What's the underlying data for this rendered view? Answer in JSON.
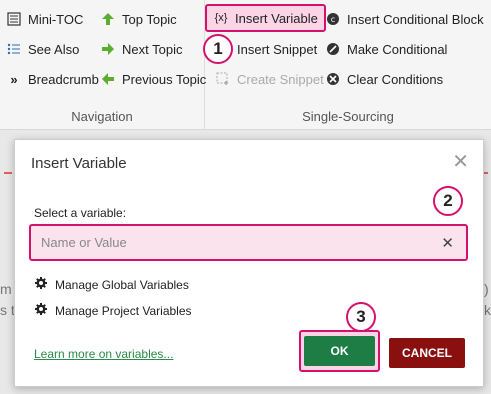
{
  "ribbon": {
    "navigation": {
      "label": "Navigation",
      "items": [
        {
          "label": "Mini-TOC",
          "icon": "mini-toc-icon"
        },
        {
          "label": "See Also",
          "icon": "list-icon"
        },
        {
          "label": "Breadcrumb",
          "icon": "double-chevron-icon"
        },
        {
          "label": "Top Topic",
          "icon": "arrow-up-icon"
        },
        {
          "label": "Next Topic",
          "icon": "arrow-right-icon"
        },
        {
          "label": "Previous Topic",
          "icon": "arrow-left-icon"
        }
      ]
    },
    "single_sourcing": {
      "label": "Single-Sourcing",
      "items": [
        {
          "label": "Insert Variable",
          "icon": "variable-icon",
          "highlighted": true
        },
        {
          "label": "Insert Snippet",
          "icon": "snippet-icon"
        },
        {
          "label": "Create Snippet",
          "icon": "create-snippet-icon",
          "disabled": true
        },
        {
          "label": "Insert Conditional Block",
          "icon": "conditional-block-icon"
        },
        {
          "label": "Make Conditional",
          "icon": "make-conditional-icon"
        },
        {
          "label": "Clear Conditions",
          "icon": "clear-conditions-icon"
        }
      ]
    }
  },
  "callouts": [
    "1",
    "2",
    "3"
  ],
  "background_text": {
    "left": "m",
    "left2": "s t",
    "right": ")",
    "right2": "k"
  },
  "dialog": {
    "title": "Insert Variable",
    "select_label": "Select a variable:",
    "input_placeholder": "Name or Value",
    "input_value": "",
    "manage_global": "Manage Global Variables",
    "manage_project": "Manage Project Variables",
    "learn_more": "Learn more on variables...",
    "ok_label": "OK",
    "cancel_label": "CANCEL"
  },
  "colors": {
    "highlight": "#d4116d",
    "ok": "#1e7d45",
    "cancel": "#8a1010"
  }
}
